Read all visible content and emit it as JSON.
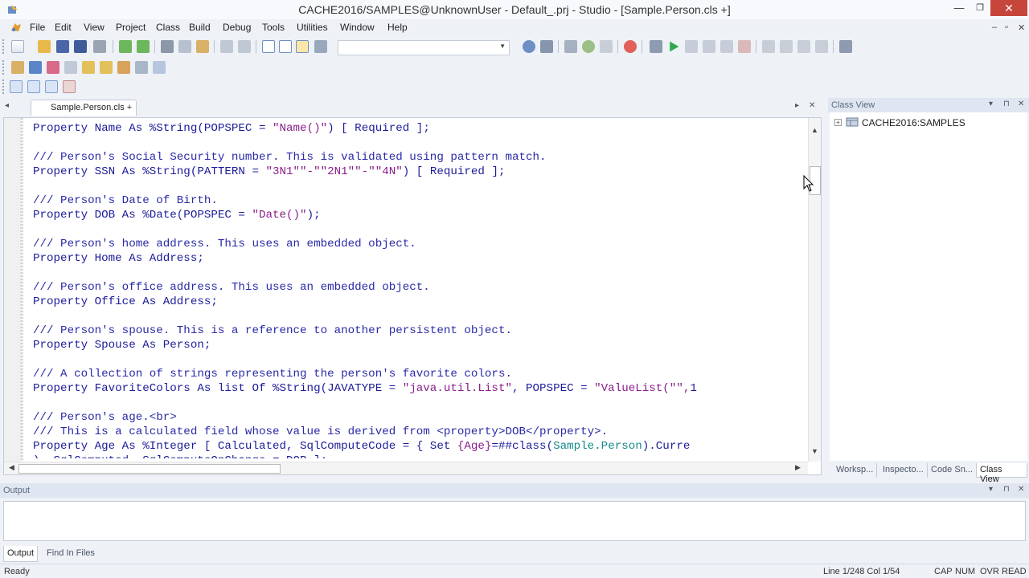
{
  "window": {
    "title": "CACHE2016/SAMPLES@UnknownUser - Default_.prj - Studio - [Sample.Person.cls +]",
    "minimize_glyph": "—",
    "restore_glyph": "❐",
    "close_glyph": "✕"
  },
  "menu": {
    "items": [
      "File",
      "Edit",
      "View",
      "Project",
      "Class",
      "Build",
      "Debug",
      "Tools",
      "Utilities",
      "Window",
      "Help"
    ],
    "mdi_minimize": "–",
    "mdi_restore": "▫",
    "mdi_close": "✕"
  },
  "editor": {
    "tab_label": "Sample.Person.cls +",
    "tab_nav_left": "◂",
    "tab_nav_right": "▸",
    "tab_close": "✕",
    "lines": [
      {
        "spans": [
          {
            "t": "Property Name As %String(POPSPEC = ",
            "c": "kw"
          },
          {
            "t": "\"Name()\"",
            "c": "str"
          },
          {
            "t": ") [ Required ];",
            "c": "kw"
          }
        ]
      },
      {
        "spans": [
          {
            "t": "",
            "c": "kw"
          }
        ]
      },
      {
        "spans": [
          {
            "t": "/// Person's Social Security number. This is validated using pattern match.",
            "c": "cm"
          }
        ]
      },
      {
        "spans": [
          {
            "t": "Property SSN As %String(PATTERN = ",
            "c": "kw"
          },
          {
            "t": "\"3N1\"\"-\"\"2N1\"\"-\"\"4N\"",
            "c": "str"
          },
          {
            "t": ") [ Required ];",
            "c": "kw"
          }
        ]
      },
      {
        "spans": [
          {
            "t": "",
            "c": "kw"
          }
        ]
      },
      {
        "spans": [
          {
            "t": "/// Person's Date of Birth.",
            "c": "cm"
          }
        ]
      },
      {
        "spans": [
          {
            "t": "Property DOB As %Date(POPSPEC = ",
            "c": "kw"
          },
          {
            "t": "\"Date()\"",
            "c": "str"
          },
          {
            "t": ");",
            "c": "kw"
          }
        ]
      },
      {
        "spans": [
          {
            "t": "",
            "c": "kw"
          }
        ]
      },
      {
        "spans": [
          {
            "t": "/// Person's home address. This uses an embedded object.",
            "c": "cm"
          }
        ]
      },
      {
        "spans": [
          {
            "t": "Property Home As Address;",
            "c": "kw"
          }
        ]
      },
      {
        "spans": [
          {
            "t": "",
            "c": "kw"
          }
        ]
      },
      {
        "spans": [
          {
            "t": "/// Person's office address. This uses an embedded object.",
            "c": "cm"
          }
        ]
      },
      {
        "spans": [
          {
            "t": "Property Office As Address;",
            "c": "kw"
          }
        ]
      },
      {
        "spans": [
          {
            "t": "",
            "c": "kw"
          }
        ]
      },
      {
        "spans": [
          {
            "t": "/// Person's spouse. This is a reference to another persistent object.",
            "c": "cm"
          }
        ]
      },
      {
        "spans": [
          {
            "t": "Property Spouse As Person;",
            "c": "kw"
          }
        ]
      },
      {
        "spans": [
          {
            "t": "",
            "c": "kw"
          }
        ]
      },
      {
        "spans": [
          {
            "t": "/// A collection of strings representing the person's favorite colors.",
            "c": "cm"
          }
        ]
      },
      {
        "spans": [
          {
            "t": "Property FavoriteColors As list Of %String(JAVATYPE = ",
            "c": "kw"
          },
          {
            "t": "\"java.util.List\"",
            "c": "str"
          },
          {
            "t": ", POPSPEC = ",
            "c": "kw"
          },
          {
            "t": "\"ValueList(\"\",",
            "c": "str"
          },
          {
            "t": "1",
            "c": "kw"
          }
        ]
      },
      {
        "spans": [
          {
            "t": "",
            "c": "kw"
          }
        ]
      },
      {
        "spans": [
          {
            "t": "/// Person's age.<br>",
            "c": "cm"
          }
        ]
      },
      {
        "spans": [
          {
            "t": "/// This is a calculated field whose value is derived from <property>DOB</property>.",
            "c": "cm"
          }
        ]
      },
      {
        "spans": [
          {
            "t": "Property Age As %Integer [ Calculated, SqlComputeCode = { Set ",
            "c": "kw"
          },
          {
            "t": "{Age}",
            "c": "str"
          },
          {
            "t": "=##class(",
            "c": "kw"
          },
          {
            "t": "Sample.Person",
            "c": "cls"
          },
          {
            "t": ").Curre",
            "c": "kw"
          }
        ]
      },
      {
        "spans": [
          {
            "t": "), SqlComputed, SqlComputeOnChange = DOB ];",
            "c": "kw"
          }
        ]
      }
    ],
    "colors": {
      "kw": "#1c1c9a",
      "cm": "#2a2aa8",
      "str": "#8a1f8a",
      "cls": "#148a8a",
      "bg": "#ffffff"
    }
  },
  "class_view": {
    "title": "Class View",
    "tree_root": "CACHE2016:SAMPLES",
    "expander": "+",
    "pin_glyph": "▾",
    "float_glyph": "⊓",
    "close_glyph": "✕",
    "tabs": [
      {
        "label": "Worksp...",
        "active": false
      },
      {
        "label": "Inspecto...",
        "active": false
      },
      {
        "label": "Code Sn...",
        "active": false
      },
      {
        "label": "Class View",
        "active": true
      }
    ]
  },
  "output": {
    "title": "Output",
    "tabs": [
      {
        "label": "Output",
        "active": true
      },
      {
        "label": "Find In Files",
        "active": false
      }
    ]
  },
  "status": {
    "ready": "Ready",
    "position": "Line 1/248 Col 1/54",
    "indicators": [
      "CAP",
      "NUM",
      "OVR",
      "READ"
    ]
  },
  "icons": {
    "app": "studio-icon",
    "tree": "namespace-icon",
    "cursor": "mouse-pointer-icon"
  }
}
